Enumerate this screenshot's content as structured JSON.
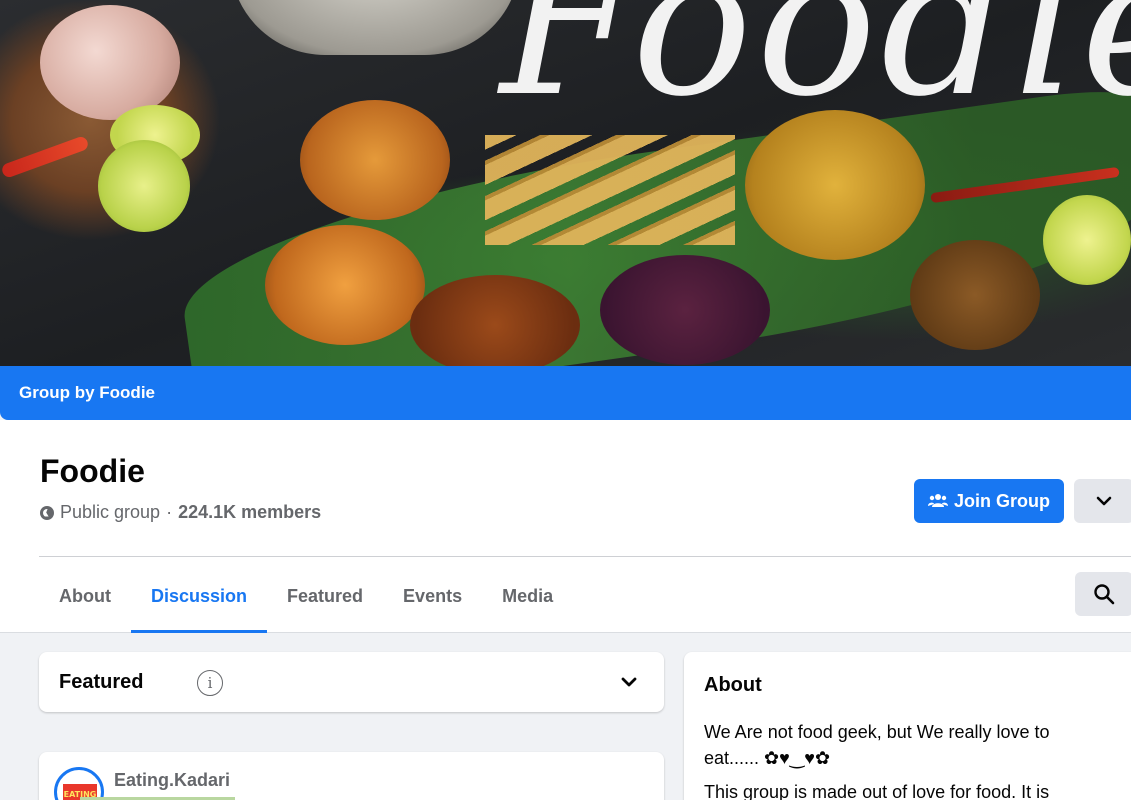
{
  "cover": {
    "title": "Foodie"
  },
  "group_bar": {
    "label": "Group by Foodie"
  },
  "header": {
    "name": "Foodie",
    "privacy": "Public group",
    "separator": "·",
    "members": "224.1K members",
    "join_label": "Join Group",
    "icons": {
      "join": "people-icon",
      "more": "chevron-down-icon",
      "privacy": "globe-icon",
      "search": "search-icon"
    }
  },
  "tabs": [
    {
      "label": "About",
      "active": false
    },
    {
      "label": "Discussion",
      "active": true
    },
    {
      "label": "Featured",
      "active": false
    },
    {
      "label": "Events",
      "active": false
    },
    {
      "label": "Media",
      "active": false
    }
  ],
  "featured": {
    "title": "Featured",
    "info_glyph": "i"
  },
  "post": {
    "author": "Eating.Kadari",
    "avatar_text": "EATING"
  },
  "about": {
    "title": "About",
    "text1": "We Are not food geek, but We really love to eat...... ✿♥‿♥✿",
    "text2": "This group is made out of love for food. It is"
  },
  "colors": {
    "brand": "#1877f2",
    "muted": "#65676b",
    "page_bg": "#f0f2f5"
  }
}
